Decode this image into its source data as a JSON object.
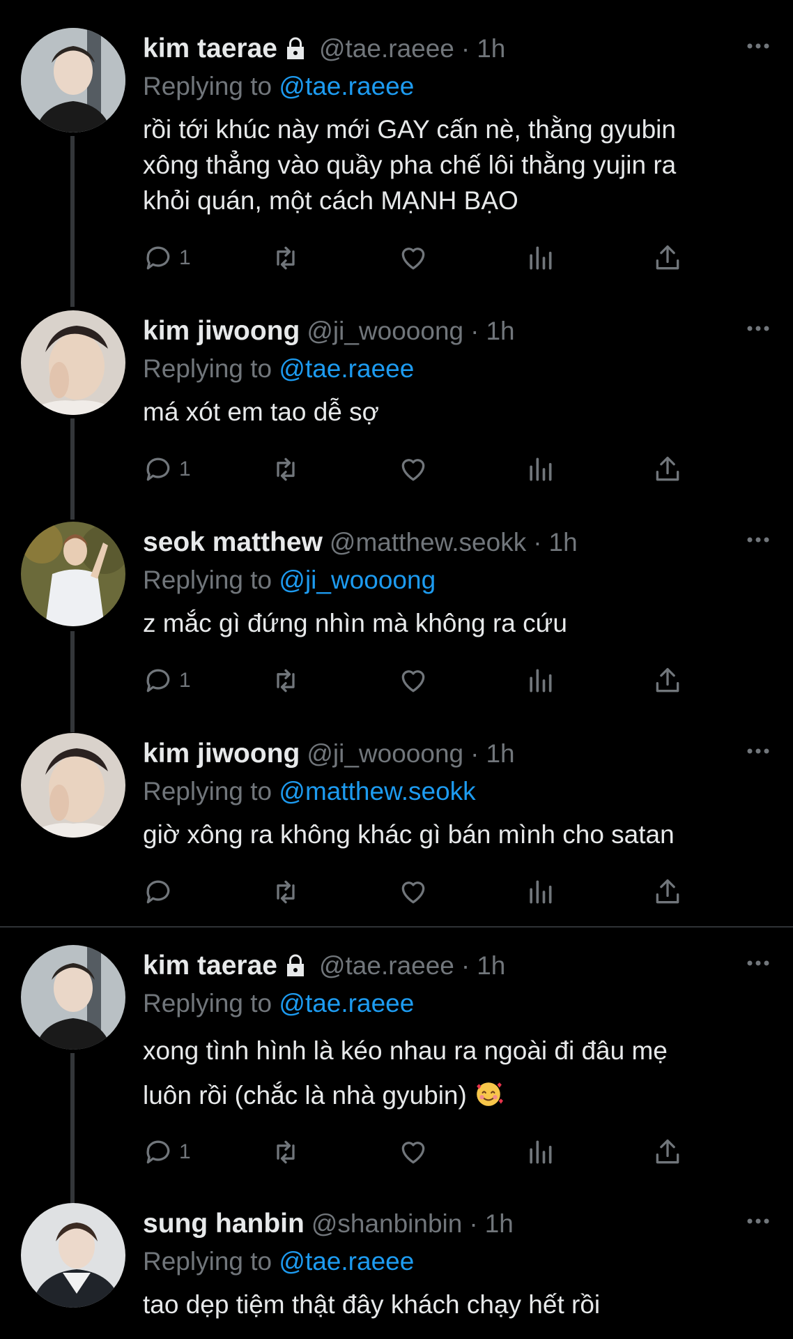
{
  "tweets": [
    {
      "name": "kim taerae",
      "locked": true,
      "handle": "@tae.raeee",
      "time": "1h",
      "replying_prefix": "Replying to",
      "replying_to": "@tae.raeee",
      "lines": [
        "rồi tới khúc này mới GAY cấn nè, thằng gyubin",
        "xông thẳng vào quầy pha chế lôi thằng yujin ra",
        "khỏi quán, một cách MẠNH BẠO"
      ],
      "reply_count": "1"
    },
    {
      "name": "kim jiwoong",
      "locked": false,
      "handle": "@ji_woooong",
      "time": "1h",
      "replying_prefix": "Replying to",
      "replying_to": "@tae.raeee",
      "lines": [
        "má xót em tao dễ sợ"
      ],
      "reply_count": "1"
    },
    {
      "name": "seok matthew",
      "locked": false,
      "handle": "@matthew.seokk",
      "time": "1h",
      "replying_prefix": "Replying to",
      "replying_to": "@ji_woooong",
      "lines": [
        "z mắc gì đứng nhìn mà không ra cứu"
      ],
      "reply_count": "1"
    },
    {
      "name": "kim jiwoong",
      "locked": false,
      "handle": "@ji_woooong",
      "time": "1h",
      "replying_prefix": "Replying to",
      "replying_to": "@matthew.seokk",
      "lines": [
        "giờ xông ra không khác gì bán mình cho satan"
      ],
      "reply_count": ""
    },
    {
      "name": "kim taerae",
      "locked": true,
      "handle": "@tae.raeee",
      "time": "1h",
      "replying_prefix": "Replying to",
      "replying_to": "@tae.raeee",
      "lines": [
        "xong tình hình là kéo nhau ra ngoài đi đâu mẹ",
        "luôn rồi (chắc là nhà gyubin)"
      ],
      "emoji": "smiling-face-with-hearts",
      "reply_count": "1"
    },
    {
      "name": "sung hanbin",
      "locked": false,
      "handle": "@shanbinbin",
      "time": "1h",
      "replying_prefix": "Replying to",
      "replying_to": "@tae.raeee",
      "lines": [
        "tao dẹp tiệm thật đây khách chạy hết rồi"
      ],
      "reply_count": ""
    }
  ],
  "colors": {
    "background": "#000000",
    "text": "#e7e9ea",
    "muted": "#71767b",
    "link": "#1d9bf0"
  },
  "icons": {
    "reply": "reply-icon",
    "retweet": "retweet-icon",
    "like": "like-icon",
    "views": "views-icon",
    "share": "share-icon",
    "more": "more-icon",
    "lock": "lock-icon"
  }
}
